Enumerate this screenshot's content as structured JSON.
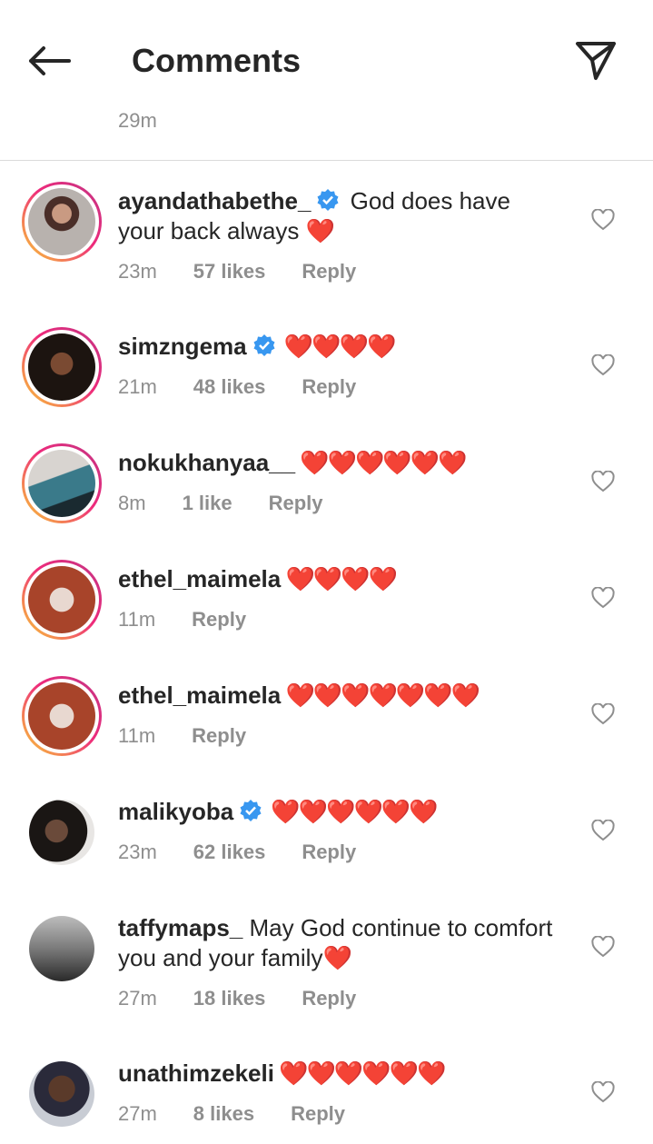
{
  "header": {
    "title": "Comments",
    "back_icon": "arrow-left-icon",
    "send_icon": "paper-plane-icon"
  },
  "top_time": "29m",
  "comments": [
    {
      "username": "ayandathabethe_",
      "verified": true,
      "text": " God does have your back always ❤️",
      "time": "23m",
      "likes": "57 likes",
      "reply": "Reply"
    },
    {
      "username": "simzngema",
      "verified": true,
      "text": " ❤️❤️❤️❤️",
      "time": "21m",
      "likes": "48 likes",
      "reply": "Reply"
    },
    {
      "username": "nokukhanyaa__",
      "verified": false,
      "text": " ❤️❤️❤️❤️❤️❤️",
      "time": "8m",
      "likes": "1 like",
      "reply": "Reply"
    },
    {
      "username": "ethel_maimela",
      "verified": false,
      "text": " ❤️❤️❤️❤️",
      "time": "11m",
      "likes": "",
      "reply": "Reply"
    },
    {
      "username": "ethel_maimela",
      "verified": false,
      "text": " ❤️❤️❤️❤️❤️❤️❤️",
      "time": "11m",
      "likes": "",
      "reply": "Reply"
    },
    {
      "username": "malikyoba",
      "verified": true,
      "text": " ❤️❤️❤️❤️❤️❤️",
      "time": "23m",
      "likes": "62 likes",
      "reply": "Reply"
    },
    {
      "username": "taffymaps_",
      "verified": false,
      "text": " May God continue to comfort you and your family❤️",
      "time": "27m",
      "likes": "18 likes",
      "reply": "Reply"
    },
    {
      "username": "unathimzekeli",
      "verified": false,
      "text": " ❤️❤️❤️❤️❤️❤️",
      "time": "27m",
      "likes": "8 likes",
      "reply": "Reply"
    }
  ],
  "colors": {
    "accent_verified": "#3897f0",
    "heart": "#e0162b",
    "meta": "#8e8e8e"
  }
}
